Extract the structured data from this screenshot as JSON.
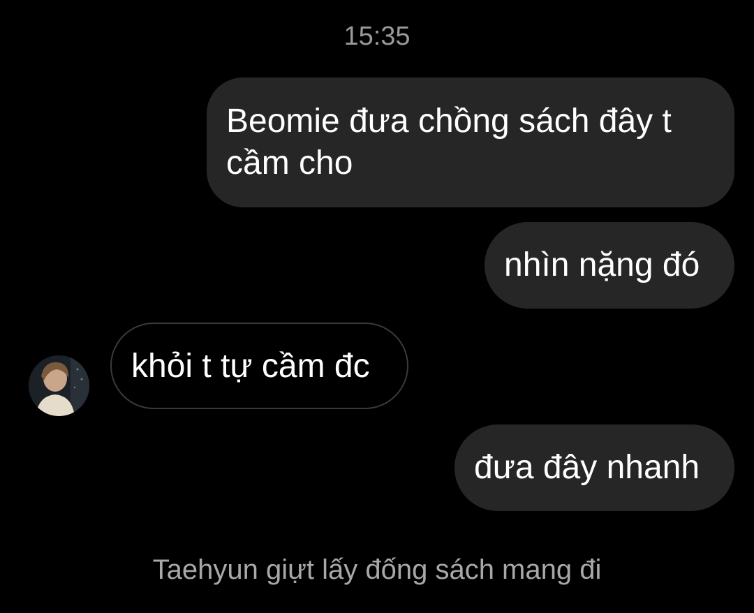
{
  "chat": {
    "timestamp": "15:35",
    "messages": [
      {
        "direction": "outgoing",
        "text": "Beomie đưa chồng sách đây t cầm cho"
      },
      {
        "direction": "outgoing",
        "text": "nhìn nặng đó"
      },
      {
        "direction": "incoming",
        "text": "khỏi t tự cầm đc"
      },
      {
        "direction": "outgoing",
        "text": "đưa đây nhanh"
      }
    ],
    "narration": "Taehyun giựt lấy đống sách mang đi"
  },
  "colors": {
    "background": "#000000",
    "outgoing_bubble": "#262626",
    "incoming_border": "#3a3a3a",
    "timestamp_text": "#9a9a9a",
    "narration_text": "#a8a8a8"
  }
}
